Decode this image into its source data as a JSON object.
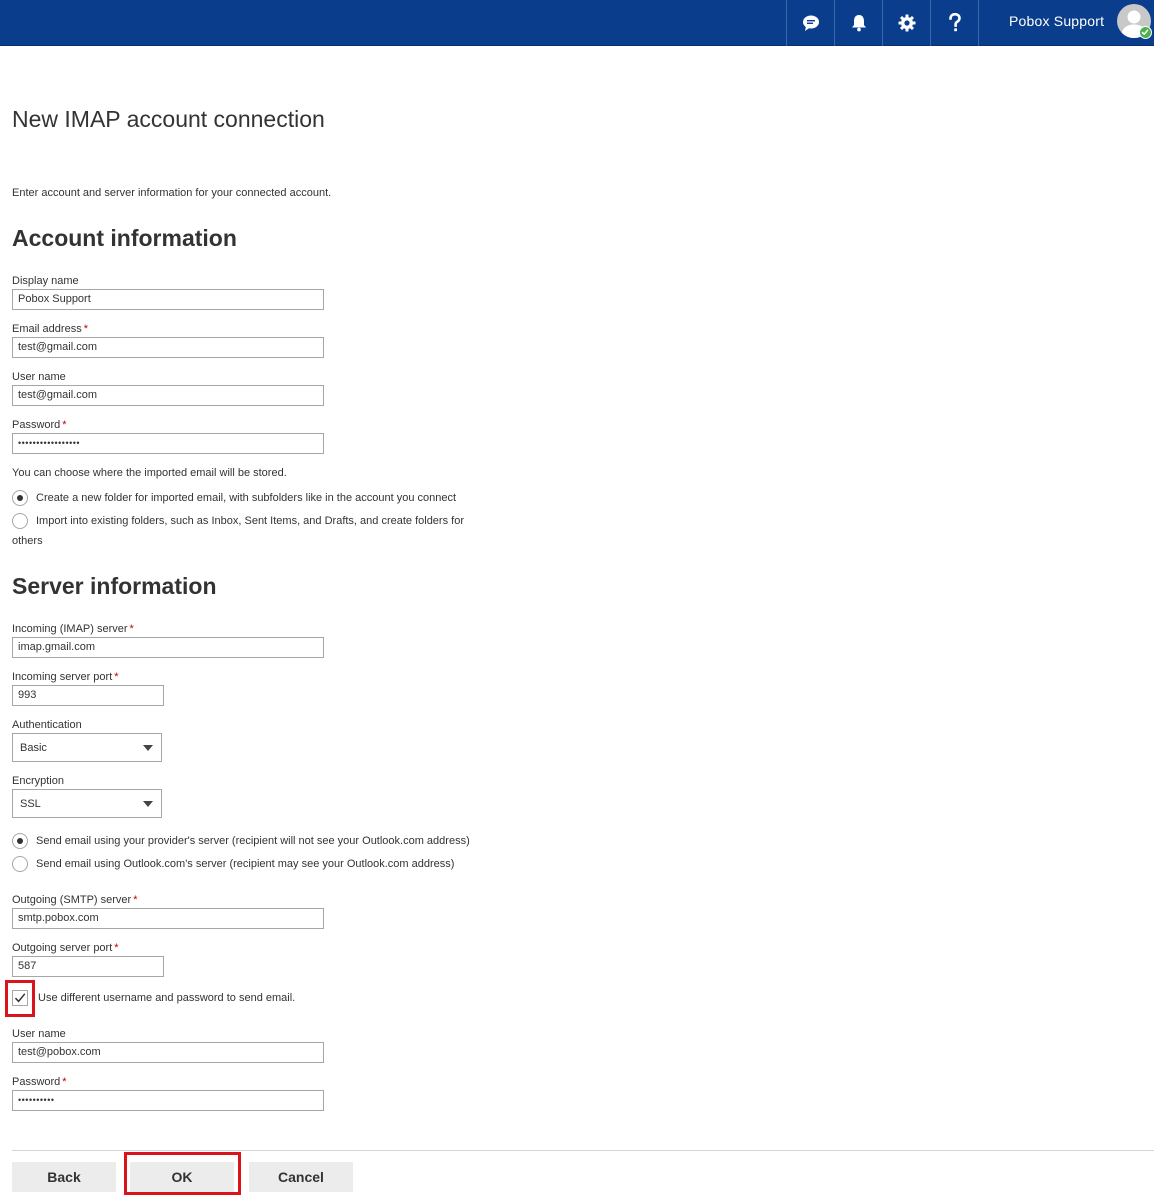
{
  "topbar": {
    "user_name": "Pobox Support",
    "icons": [
      "chat-icon",
      "bell-icon",
      "gear-icon",
      "help-icon"
    ],
    "background": "#0a3e8c"
  },
  "page": {
    "title": "New IMAP account connection",
    "intro": "Enter account and server information for your connected account."
  },
  "account": {
    "heading": "Account information",
    "display_name_label": "Display name",
    "display_name_value": "Pobox Support",
    "email_label": "Email address",
    "email_value": "test@gmail.com",
    "username_label": "User name",
    "username_value": "test@gmail.com",
    "password_label": "Password",
    "password_value": "•••••••••••••••••",
    "storage_prompt": "You can choose where the imported email will be stored.",
    "storage_option_1": "Create a new folder for imported email, with subfolders like in the account you connect",
    "storage_option_2_line1": "Import into existing folders, such as Inbox, Sent Items, and Drafts, and create folders for",
    "storage_option_2_line2": "others",
    "storage_selected": 1
  },
  "server": {
    "heading": "Server information",
    "incoming_server_label": "Incoming (IMAP) server",
    "incoming_server_value": "imap.gmail.com",
    "incoming_port_label": "Incoming server port",
    "incoming_port_value": "993",
    "auth_label": "Authentication",
    "auth_value": "Basic",
    "encryption_label": "Encryption",
    "encryption_value": "SSL",
    "send_option_1": "Send email using your provider's server (recipient will not see your Outlook.com address)",
    "send_option_2": "Send email using Outlook.com's server (recipient may see your Outlook.com address)",
    "send_selected": 1,
    "outgoing_server_label": "Outgoing (SMTP) server",
    "outgoing_server_value": "smtp.pobox.com",
    "outgoing_port_label": "Outgoing server port",
    "outgoing_port_value": "587",
    "different_credentials_label": "Use different username and password to send email.",
    "different_credentials_checked": true,
    "smtp_username_label": "User name",
    "smtp_username_value": "test@pobox.com",
    "smtp_password_label": "Password",
    "smtp_password_value": "••••••••••"
  },
  "actions": {
    "back_label": "Back",
    "ok_label": "OK",
    "cancel_label": "Cancel"
  },
  "required_marker": "*",
  "colors": {
    "required": "#c00000",
    "highlight": "#d9141b"
  }
}
